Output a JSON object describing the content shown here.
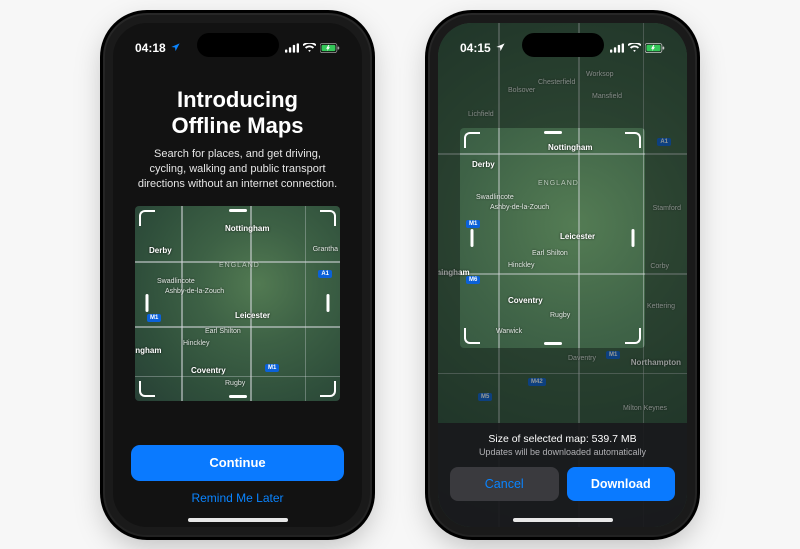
{
  "phone1": {
    "status": {
      "time": "04:18"
    },
    "title_line1": "Introducing",
    "title_line2": "Offline Maps",
    "desc": "Search for places, and get driving, cycling, walking and public transport directions without an internet connection.",
    "map": {
      "region": "ENGLAND",
      "cities": {
        "nottingham": "Nottingham",
        "derby": "Derby",
        "leicester": "Leicester",
        "coventry": "Coventry",
        "rugby": "Rugby",
        "swadlincote": "Swadlincote",
        "ashby": "Ashby-de-la-Zouch",
        "earlshilton": "Earl Shilton",
        "hinckley": "Hinckley",
        "ingham": "ingham",
        "grantham": "Grantha"
      },
      "motorways": {
        "m1a": "M1",
        "m1b": "M1",
        "a1": "A1"
      }
    },
    "continue": "Continue",
    "remind": "Remind Me Later"
  },
  "phone2": {
    "status": {
      "time": "04:15"
    },
    "map": {
      "region": "ENGLAND",
      "cities": {
        "nottingham": "Nottingham",
        "derby": "Derby",
        "leicester": "Leicester",
        "coventry": "Coventry",
        "rugby": "Rugby",
        "swadlincote": "Swadlincote",
        "ashby": "Ashby-de-la-Zouch",
        "earlshilton": "Earl Shilton",
        "hinckley": "Hinckley",
        "warwick": "Warwick",
        "daventry": "Daventry",
        "northampton": "Northampton",
        "miltonkeynes": "Milton Keynes",
        "stamford": "Stamford",
        "corby": "Corby",
        "kettering": "Kettering",
        "chesterfield": "Chesterfield",
        "mansfield": "Mansfield",
        "worksop": "Worksop",
        "bolsover": "Bolsover",
        "lichfield": "Lichfield",
        "birmingham": "mingham"
      },
      "motorways": {
        "m1a": "M1",
        "m1b": "M1",
        "m6": "M6",
        "m5": "M5",
        "m42": "M42",
        "a1": "A1"
      }
    },
    "footer": {
      "size_label": "Size of selected map: 539.7 MB",
      "update_label": "Updates will be downloaded automatically",
      "cancel": "Cancel",
      "download": "Download"
    }
  }
}
